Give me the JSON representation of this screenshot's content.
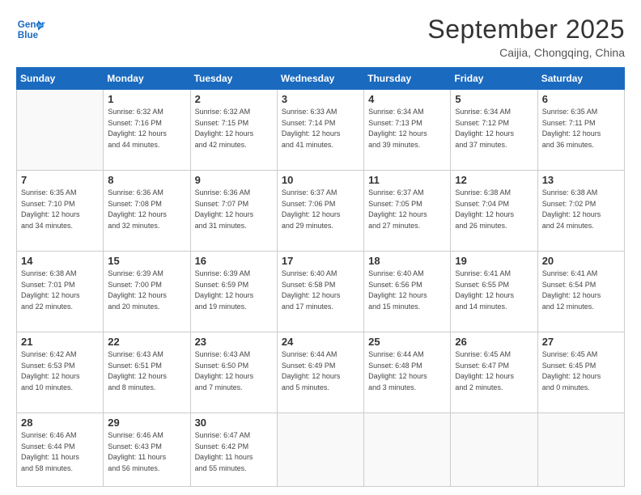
{
  "logo": {
    "line1": "General",
    "line2": "Blue"
  },
  "title": "September 2025",
  "subtitle": "Caijia, Chongqing, China",
  "weekdays": [
    "Sunday",
    "Monday",
    "Tuesday",
    "Wednesday",
    "Thursday",
    "Friday",
    "Saturday"
  ],
  "weeks": [
    [
      {
        "day": "",
        "info": ""
      },
      {
        "day": "1",
        "info": "Sunrise: 6:32 AM\nSunset: 7:16 PM\nDaylight: 12 hours\nand 44 minutes."
      },
      {
        "day": "2",
        "info": "Sunrise: 6:32 AM\nSunset: 7:15 PM\nDaylight: 12 hours\nand 42 minutes."
      },
      {
        "day": "3",
        "info": "Sunrise: 6:33 AM\nSunset: 7:14 PM\nDaylight: 12 hours\nand 41 minutes."
      },
      {
        "day": "4",
        "info": "Sunrise: 6:34 AM\nSunset: 7:13 PM\nDaylight: 12 hours\nand 39 minutes."
      },
      {
        "day": "5",
        "info": "Sunrise: 6:34 AM\nSunset: 7:12 PM\nDaylight: 12 hours\nand 37 minutes."
      },
      {
        "day": "6",
        "info": "Sunrise: 6:35 AM\nSunset: 7:11 PM\nDaylight: 12 hours\nand 36 minutes."
      }
    ],
    [
      {
        "day": "7",
        "info": "Sunrise: 6:35 AM\nSunset: 7:10 PM\nDaylight: 12 hours\nand 34 minutes."
      },
      {
        "day": "8",
        "info": "Sunrise: 6:36 AM\nSunset: 7:08 PM\nDaylight: 12 hours\nand 32 minutes."
      },
      {
        "day": "9",
        "info": "Sunrise: 6:36 AM\nSunset: 7:07 PM\nDaylight: 12 hours\nand 31 minutes."
      },
      {
        "day": "10",
        "info": "Sunrise: 6:37 AM\nSunset: 7:06 PM\nDaylight: 12 hours\nand 29 minutes."
      },
      {
        "day": "11",
        "info": "Sunrise: 6:37 AM\nSunset: 7:05 PM\nDaylight: 12 hours\nand 27 minutes."
      },
      {
        "day": "12",
        "info": "Sunrise: 6:38 AM\nSunset: 7:04 PM\nDaylight: 12 hours\nand 26 minutes."
      },
      {
        "day": "13",
        "info": "Sunrise: 6:38 AM\nSunset: 7:02 PM\nDaylight: 12 hours\nand 24 minutes."
      }
    ],
    [
      {
        "day": "14",
        "info": "Sunrise: 6:38 AM\nSunset: 7:01 PM\nDaylight: 12 hours\nand 22 minutes."
      },
      {
        "day": "15",
        "info": "Sunrise: 6:39 AM\nSunset: 7:00 PM\nDaylight: 12 hours\nand 20 minutes."
      },
      {
        "day": "16",
        "info": "Sunrise: 6:39 AM\nSunset: 6:59 PM\nDaylight: 12 hours\nand 19 minutes."
      },
      {
        "day": "17",
        "info": "Sunrise: 6:40 AM\nSunset: 6:58 PM\nDaylight: 12 hours\nand 17 minutes."
      },
      {
        "day": "18",
        "info": "Sunrise: 6:40 AM\nSunset: 6:56 PM\nDaylight: 12 hours\nand 15 minutes."
      },
      {
        "day": "19",
        "info": "Sunrise: 6:41 AM\nSunset: 6:55 PM\nDaylight: 12 hours\nand 14 minutes."
      },
      {
        "day": "20",
        "info": "Sunrise: 6:41 AM\nSunset: 6:54 PM\nDaylight: 12 hours\nand 12 minutes."
      }
    ],
    [
      {
        "day": "21",
        "info": "Sunrise: 6:42 AM\nSunset: 6:53 PM\nDaylight: 12 hours\nand 10 minutes."
      },
      {
        "day": "22",
        "info": "Sunrise: 6:43 AM\nSunset: 6:51 PM\nDaylight: 12 hours\nand 8 minutes."
      },
      {
        "day": "23",
        "info": "Sunrise: 6:43 AM\nSunset: 6:50 PM\nDaylight: 12 hours\nand 7 minutes."
      },
      {
        "day": "24",
        "info": "Sunrise: 6:44 AM\nSunset: 6:49 PM\nDaylight: 12 hours\nand 5 minutes."
      },
      {
        "day": "25",
        "info": "Sunrise: 6:44 AM\nSunset: 6:48 PM\nDaylight: 12 hours\nand 3 minutes."
      },
      {
        "day": "26",
        "info": "Sunrise: 6:45 AM\nSunset: 6:47 PM\nDaylight: 12 hours\nand 2 minutes."
      },
      {
        "day": "27",
        "info": "Sunrise: 6:45 AM\nSunset: 6:45 PM\nDaylight: 12 hours\nand 0 minutes."
      }
    ],
    [
      {
        "day": "28",
        "info": "Sunrise: 6:46 AM\nSunset: 6:44 PM\nDaylight: 11 hours\nand 58 minutes."
      },
      {
        "day": "29",
        "info": "Sunrise: 6:46 AM\nSunset: 6:43 PM\nDaylight: 11 hours\nand 56 minutes."
      },
      {
        "day": "30",
        "info": "Sunrise: 6:47 AM\nSunset: 6:42 PM\nDaylight: 11 hours\nand 55 minutes."
      },
      {
        "day": "",
        "info": ""
      },
      {
        "day": "",
        "info": ""
      },
      {
        "day": "",
        "info": ""
      },
      {
        "day": "",
        "info": ""
      }
    ]
  ]
}
